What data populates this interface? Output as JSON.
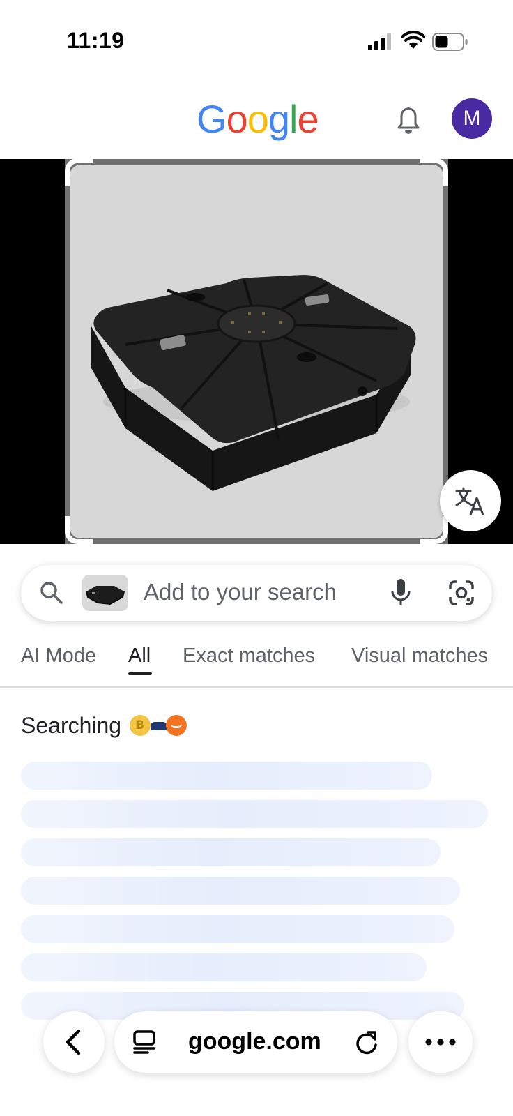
{
  "status_bar": {
    "time": "11:19"
  },
  "header": {
    "logo_text": [
      "G",
      "o",
      "o",
      "g",
      "l",
      "e"
    ],
    "logo_colors": [
      "#4285F4",
      "#EA4335",
      "#FBBC05",
      "#4285F4",
      "#34A853",
      "#EA4335"
    ],
    "avatar_letter": "M",
    "avatar_color": "#4a2aa3"
  },
  "search": {
    "placeholder": "Add to your search"
  },
  "tabs": [
    {
      "label": "AI Mode",
      "active": false
    },
    {
      "label": "All",
      "active": true
    },
    {
      "label": "Exact matches",
      "active": false
    },
    {
      "label": "Visual matches",
      "active": false
    }
  ],
  "results": {
    "status_text": "Searching"
  },
  "browser": {
    "url": "google.com"
  }
}
